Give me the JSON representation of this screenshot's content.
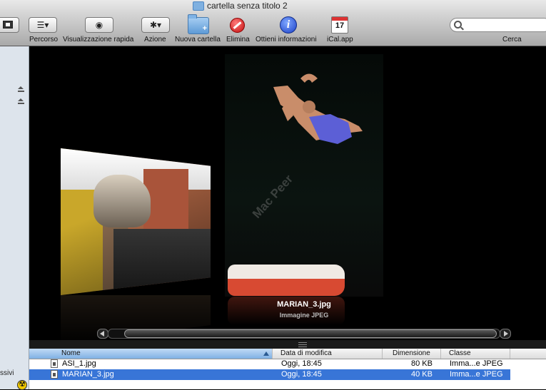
{
  "window": {
    "title": "cartella senza titolo 2"
  },
  "toolbar": {
    "items": [
      {
        "label": "Percorso"
      },
      {
        "label": "Visualizzazione rapida"
      },
      {
        "label": "Azione"
      },
      {
        "label": "Nuova cartella"
      },
      {
        "label": "Elimina"
      },
      {
        "label": "Ottieni informazioni"
      },
      {
        "label": "iCal.app"
      }
    ],
    "ical_day": "17",
    "search": {
      "label": "Cerca",
      "value": ""
    }
  },
  "sidebar": {
    "partial_label": "ssivi"
  },
  "coverflow": {
    "watermark": "Mac Peer",
    "selected_title": "MARIAN_3.jpg",
    "selected_subtitle": "Immagine JPEG"
  },
  "list": {
    "columns": [
      "Nome",
      "Data di modifica",
      "Dimensione",
      "Classe"
    ],
    "sorted_column": "Nome",
    "rows": [
      {
        "name": "ASI_1.jpg",
        "date": "Oggi, 18:45",
        "size": "80 KB",
        "kind": "Imma...e JPEG",
        "selected": false
      },
      {
        "name": "MARIAN_3.jpg",
        "date": "Oggi, 18:45",
        "size": "40 KB",
        "kind": "Imma...e JPEG",
        "selected": true
      }
    ]
  },
  "colors": {
    "selection": "#3875d7",
    "sidebar": "#dde4ec",
    "coverflow_bg": "#000000"
  }
}
